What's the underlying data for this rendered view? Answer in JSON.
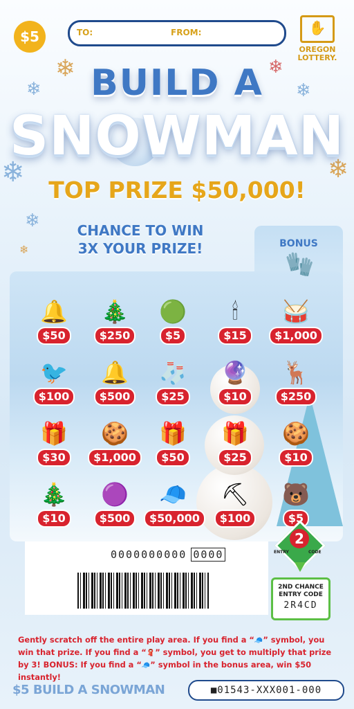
{
  "price_badge": "$5",
  "address": {
    "to_label": "TO:",
    "from_label": "FROM:"
  },
  "logo": {
    "name": "OREGON\nLOTTERY."
  },
  "title": {
    "line1": "BUILD A",
    "line2": "SNOWMAN"
  },
  "top_prize": "TOP PRIZE $50,000!",
  "chance": "CHANCE TO WIN\n3X YOUR PRIZE!",
  "bonus_label": "BONUS",
  "play_symbols": [
    {
      "icon": "🔔",
      "icon_name": "bells-icon",
      "prize": "$50"
    },
    {
      "icon": "🎄",
      "icon_name": "christmas-tree-icon",
      "prize": "$250"
    },
    {
      "icon": "🟢",
      "icon_name": "wreath-icon",
      "prize": "$5"
    },
    {
      "icon": "🕯",
      "icon_name": "candle-icon",
      "prize": "$15"
    },
    {
      "icon": "🥁",
      "icon_name": "drum-icon",
      "prize": "$1,000"
    },
    {
      "icon": "🐦",
      "icon_name": "cardinal-icon",
      "prize": "$100"
    },
    {
      "icon": "🔔",
      "icon_name": "hand-bell-icon",
      "prize": "$500"
    },
    {
      "icon": "🧦",
      "icon_name": "stocking-icon",
      "prize": "$25"
    },
    {
      "icon": "🔮",
      "icon_name": "snow-globe-icon",
      "prize": "$10"
    },
    {
      "icon": "🦌",
      "icon_name": "reindeer-icon",
      "prize": "$250"
    },
    {
      "icon": "🎁",
      "icon_name": "gift-icon",
      "prize": "$30"
    },
    {
      "icon": "🍪",
      "icon_name": "cookie-icon",
      "prize": "$1,000"
    },
    {
      "icon": "🎁",
      "icon_name": "red-gift-icon",
      "prize": "$50"
    },
    {
      "icon": "🎁",
      "icon_name": "green-gift-icon",
      "prize": "$25"
    },
    {
      "icon": "🍪",
      "icon_name": "gingerbread-man-icon",
      "prize": "$10"
    },
    {
      "icon": "🎄",
      "icon_name": "tree-cookie-icon",
      "prize": "$10"
    },
    {
      "icon": "🟣",
      "icon_name": "ornament-icon",
      "prize": "$500"
    },
    {
      "icon": "🧢",
      "icon_name": "win-hat-icon",
      "prize": "$50,000"
    },
    {
      "icon": "⛏",
      "icon_name": "shovel-icon",
      "prize": "$100"
    },
    {
      "icon": "🐻",
      "icon_name": "polar-bear-icon",
      "prize": "$5"
    }
  ],
  "bonus_symbol": {
    "icon": "🧤",
    "icon_name": "mitten-icon"
  },
  "serial": {
    "digits": "0000000000",
    "box": "0000"
  },
  "second_chance": {
    "badge_number": "2",
    "entry_left": "ENTRY",
    "entry_right": "CODE",
    "box_label": "2ND CHANCE\nENTRY CODE",
    "code": "2R4CD"
  },
  "instructions": {
    "line1_a": "Gently scratch off the entire play area. If you find a “",
    "line1_b": "” symbol, you win that prize. If you find a “",
    "line1_c": "” symbol, you get to multiply that prize by 3!",
    "bonus_label": "BONUS:",
    "line2_a": "If you find a “",
    "line2_b": "” symbol in the bonus area, win $50 instantly!"
  },
  "footer_title": "$5 BUILD A SNOWMAN",
  "ticket_number": "■01543-XXX001-000",
  "colors": {
    "accent_blue": "#3f78c4",
    "gold": "#e6a61a",
    "red": "#d8232e",
    "green": "#5cbf45"
  }
}
